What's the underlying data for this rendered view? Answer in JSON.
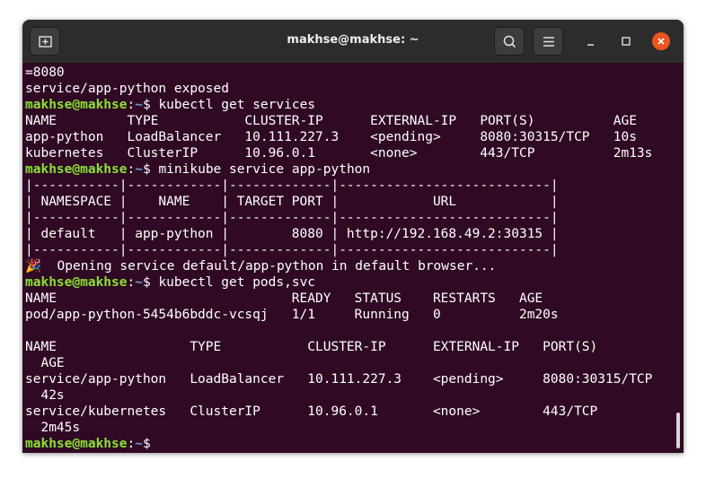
{
  "window": {
    "title": "makhse@makhse: ~"
  },
  "prompt": {
    "user": "makhse@makhse",
    "sep": ":",
    "path": "~",
    "dollar": "$ "
  },
  "lines": [
    {
      "text": "=8080"
    },
    {
      "text": "service/app-python exposed"
    },
    {
      "cmd": "kubectl get services"
    },
    {
      "text": "NAME         TYPE           CLUSTER-IP      EXTERNAL-IP   PORT(S)          AGE"
    },
    {
      "text": "app-python   LoadBalancer   10.111.227.3    <pending>     8080:30315/TCP   10s"
    },
    {
      "text": "kubernetes   ClusterIP      10.96.0.1       <none>        443/TCP          2m13s"
    },
    {
      "cmd": "minikube service app-python"
    },
    {
      "text": "|-----------|------------|-------------|---------------------------|"
    },
    {
      "text": "| NAMESPACE |    NAME    | TARGET PORT |            URL            |"
    },
    {
      "text": "|-----------|------------|-------------|---------------------------|"
    },
    {
      "text": "| default   | app-python |        8080 | http://192.168.49.2:30315 |"
    },
    {
      "text": "|-----------|------------|-------------|---------------------------|"
    },
    {
      "text": "🎉  Opening service default/app-python in default browser..."
    },
    {
      "cmd": "kubectl get pods,svc"
    },
    {
      "text": "NAME                              READY   STATUS    RESTARTS   AGE"
    },
    {
      "text": "pod/app-python-5454b6bddc-vcsqj   1/1     Running   0          2m20s"
    },
    {
      "text": ""
    },
    {
      "text": "NAME                 TYPE           CLUSTER-IP      EXTERNAL-IP   PORT(S)"
    },
    {
      "text": "  AGE"
    },
    {
      "text": "service/app-python   LoadBalancer   10.111.227.3    <pending>     8080:30315/TCP"
    },
    {
      "text": "  42s"
    },
    {
      "text": "service/kubernetes   ClusterIP      10.96.0.1       <none>        443/TCP"
    },
    {
      "text": "  2m45s"
    },
    {
      "cmd": ""
    }
  ],
  "colors": {
    "background": "#300a24",
    "prompt_user": "#8ae234",
    "prompt_path": "#729fcf",
    "close_button": "#e95420"
  }
}
